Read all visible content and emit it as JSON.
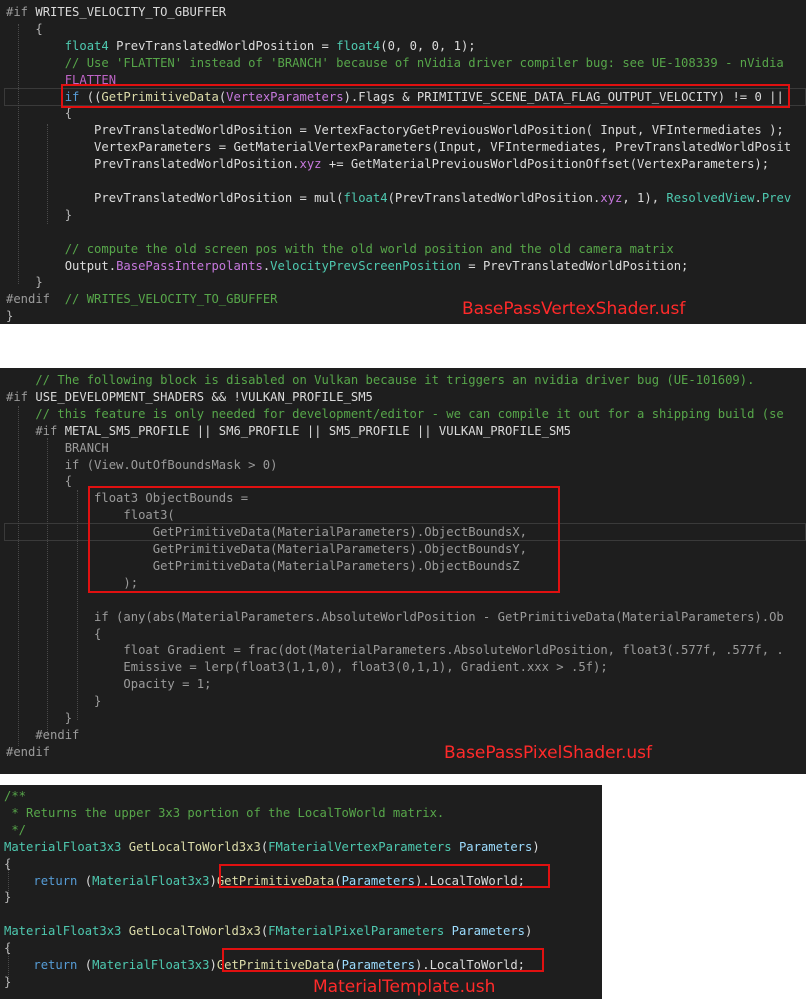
{
  "panels": [
    {
      "caption": "BasePassVertexShader.usf",
      "lines": [
        [
          [
            "t-pp",
            "#if "
          ],
          [
            "t-mb",
            "WRITES_VELOCITY_TO_GBUFFER"
          ]
        ],
        [
          [
            "t-op",
            "    {"
          ]
        ],
        [
          [
            "t-id",
            "        "
          ],
          [
            "t-ty",
            "float4"
          ],
          [
            "t-id",
            " PrevTranslatedWorldPosition = "
          ],
          [
            "t-ty",
            "float4"
          ],
          [
            "t-id",
            "(0, 0, 0, 1);"
          ]
        ],
        [
          [
            "t-cm",
            "        // Use 'FLATTEN' instead of 'BRANCH' because of nVidia driver compiler bug: see UE-108339 - nVidia"
          ]
        ],
        [
          [
            "t-mac",
            "        FLATTEN"
          ]
        ],
        [
          [
            "t-id",
            "        "
          ],
          [
            "t-kw",
            "if"
          ],
          [
            "t-id",
            " (("
          ],
          [
            "t-fn",
            "GetPrimitiveData"
          ],
          [
            "t-id",
            "("
          ],
          [
            "t-hl",
            "VertexParameters"
          ],
          [
            "t-id",
            ").Flags & PRIMITIVE_SCENE_DATA_FLAG_OUTPUT_VELOCITY) != 0 ||"
          ]
        ],
        [
          [
            "t-op",
            "        {"
          ]
        ],
        [
          [
            "t-id",
            "            PrevTranslatedWorldPosition = VertexFactoryGetPreviousWorldPosition( Input, VFIntermediates );"
          ]
        ],
        [
          [
            "t-id",
            "            VertexParameters = GetMaterialVertexParameters(Input, VFIntermediates, PrevTranslatedWorldPosit"
          ]
        ],
        [
          [
            "t-id",
            "            PrevTranslatedWorldPosition."
          ],
          [
            "t-hl",
            "xyz"
          ],
          [
            "t-id",
            " += GetMaterialPreviousWorldPositionOffset(VertexParameters);"
          ]
        ],
        [
          [
            "t-id",
            ""
          ]
        ],
        [
          [
            "t-id",
            "            PrevTranslatedWorldPosition = mul("
          ],
          [
            "t-ty",
            "float4"
          ],
          [
            "t-id",
            "(PrevTranslatedWorldPosition."
          ],
          [
            "t-hl",
            "xyz"
          ],
          [
            "t-id",
            ", 1), "
          ],
          [
            "t-ty",
            "ResolvedView"
          ],
          [
            "t-id",
            "."
          ],
          [
            "t-ty",
            "Prev"
          ]
        ],
        [
          [
            "t-op",
            "        }"
          ]
        ],
        [
          [
            "t-id",
            ""
          ]
        ],
        [
          [
            "t-cm",
            "        // compute the old screen pos with the old world position and the old camera matrix"
          ]
        ],
        [
          [
            "t-id",
            "        Output."
          ],
          [
            "t-hl",
            "BasePassInterpolants"
          ],
          [
            "t-id",
            "."
          ],
          [
            "t-ty",
            "VelocityPrevScreenPosition"
          ],
          [
            "t-id",
            " = PrevTranslatedWorldPosition;"
          ]
        ],
        [
          [
            "t-op",
            "    }"
          ]
        ],
        [
          [
            "t-pp",
            "#endif"
          ],
          [
            "t-cm",
            "  // WRITES_VELOCITY_TO_GBUFFER"
          ]
        ],
        [
          [
            "t-op",
            "}"
          ]
        ]
      ]
    },
    {
      "caption": "BasePassPixelShader.usf",
      "lines": [
        [
          [
            "t-cm",
            "    // The following block is disabled on Vulkan because it triggers an nvidia driver bug (UE-101609)."
          ]
        ],
        [
          [
            "t-pp",
            "#if "
          ],
          [
            "t-mb",
            "USE_DEVELOPMENT_SHADERS && !VULKAN_PROFILE_SM5"
          ]
        ],
        [
          [
            "t-cm",
            "    // this feature is only needed for development/editor - we can compile it out for a shipping build (se"
          ]
        ],
        [
          [
            "t-pp",
            "    #if "
          ],
          [
            "t-mb",
            "METAL_SM5_PROFILE || SM6_PROFILE || SM5_PROFILE || VULKAN_PROFILE_SM5"
          ]
        ],
        [
          [
            "t-pp",
            "        BRANCH"
          ]
        ],
        [
          [
            "t-pp",
            "        if (View.OutOfBoundsMask > 0)"
          ]
        ],
        [
          [
            "t-pp",
            "        {"
          ]
        ],
        [
          [
            "t-pp",
            "            float3 ObjectBounds ="
          ]
        ],
        [
          [
            "t-pp",
            "                float3("
          ]
        ],
        [
          [
            "t-pp",
            "                    GetPrimitiveData(MaterialParameters).ObjectBoundsX,"
          ]
        ],
        [
          [
            "t-pp",
            "                    GetPrimitiveData(MaterialParameters).ObjectBoundsY,"
          ]
        ],
        [
          [
            "t-pp",
            "                    GetPrimitiveData(MaterialParameters).ObjectBoundsZ"
          ]
        ],
        [
          [
            "t-pp",
            "                );"
          ]
        ],
        [
          [
            "t-pp",
            ""
          ]
        ],
        [
          [
            "t-pp",
            "            if (any(abs(MaterialParameters.AbsoluteWorldPosition - GetPrimitiveData(MaterialParameters).Ob"
          ]
        ],
        [
          [
            "t-pp",
            "            {"
          ]
        ],
        [
          [
            "t-pp",
            "                float Gradient = frac(dot(MaterialParameters.AbsoluteWorldPosition, float3(.577f, .577f, ."
          ]
        ],
        [
          [
            "t-pp",
            "                Emissive = lerp(float3(1,1,0), float3(0,1,1), Gradient.xxx > .5f);"
          ]
        ],
        [
          [
            "t-pp",
            "                Opacity = 1;"
          ]
        ],
        [
          [
            "t-pp",
            "            }"
          ]
        ],
        [
          [
            "t-pp",
            "        }"
          ]
        ],
        [
          [
            "t-pp",
            "    #endif"
          ]
        ],
        [
          [
            "t-pp",
            "#endif"
          ]
        ]
      ]
    },
    {
      "caption": "MaterialTemplate.ush",
      "lines": [
        [
          [
            "t-cm",
            "/**"
          ]
        ],
        [
          [
            "t-cm",
            " * Returns the upper 3x3 portion of the LocalToWorld matrix."
          ]
        ],
        [
          [
            "t-cm",
            " */"
          ]
        ],
        [
          [
            "t-ty",
            "MaterialFloat3x3"
          ],
          [
            "t-id",
            " "
          ],
          [
            "t-fn",
            "GetLocalToWorld3x3"
          ],
          [
            "t-id",
            "("
          ],
          [
            "t-ty",
            "FMaterialVertexParameters"
          ],
          [
            "t-id",
            " "
          ],
          [
            "t-pm",
            "Parameters"
          ],
          [
            "t-id",
            ")"
          ]
        ],
        [
          [
            "t-op",
            "{"
          ]
        ],
        [
          [
            "t-id",
            "    "
          ],
          [
            "t-kw",
            "return"
          ],
          [
            "t-id",
            " ("
          ],
          [
            "t-ty",
            "MaterialFloat3x3"
          ],
          [
            "t-id",
            ")"
          ],
          [
            "t-fn",
            "GetPrimitiveData"
          ],
          [
            "t-id",
            "("
          ],
          [
            "t-pm",
            "Parameters"
          ],
          [
            "t-id",
            ").LocalToWorld;"
          ]
        ],
        [
          [
            "t-op",
            "}"
          ]
        ],
        [
          [
            "t-id",
            ""
          ]
        ],
        [
          [
            "t-ty",
            "MaterialFloat3x3"
          ],
          [
            "t-id",
            " "
          ],
          [
            "t-fn",
            "GetLocalToWorld3x3"
          ],
          [
            "t-id",
            "("
          ],
          [
            "t-ty",
            "FMaterialPixelParameters"
          ],
          [
            "t-id",
            " "
          ],
          [
            "t-pm",
            "Parameters"
          ],
          [
            "t-id",
            ")"
          ]
        ],
        [
          [
            "t-op",
            "{"
          ]
        ],
        [
          [
            "t-id",
            "    "
          ],
          [
            "t-kw",
            "return"
          ],
          [
            "t-id",
            " ("
          ],
          [
            "t-ty",
            "MaterialFloat3x3"
          ],
          [
            "t-id",
            ")"
          ],
          [
            "t-fn",
            "GetPrimitiveData"
          ],
          [
            "t-id",
            "("
          ],
          [
            "t-pm",
            "Parameters"
          ],
          [
            "t-id",
            ").LocalToWorld;"
          ]
        ],
        [
          [
            "t-op",
            "}"
          ]
        ]
      ]
    }
  ]
}
